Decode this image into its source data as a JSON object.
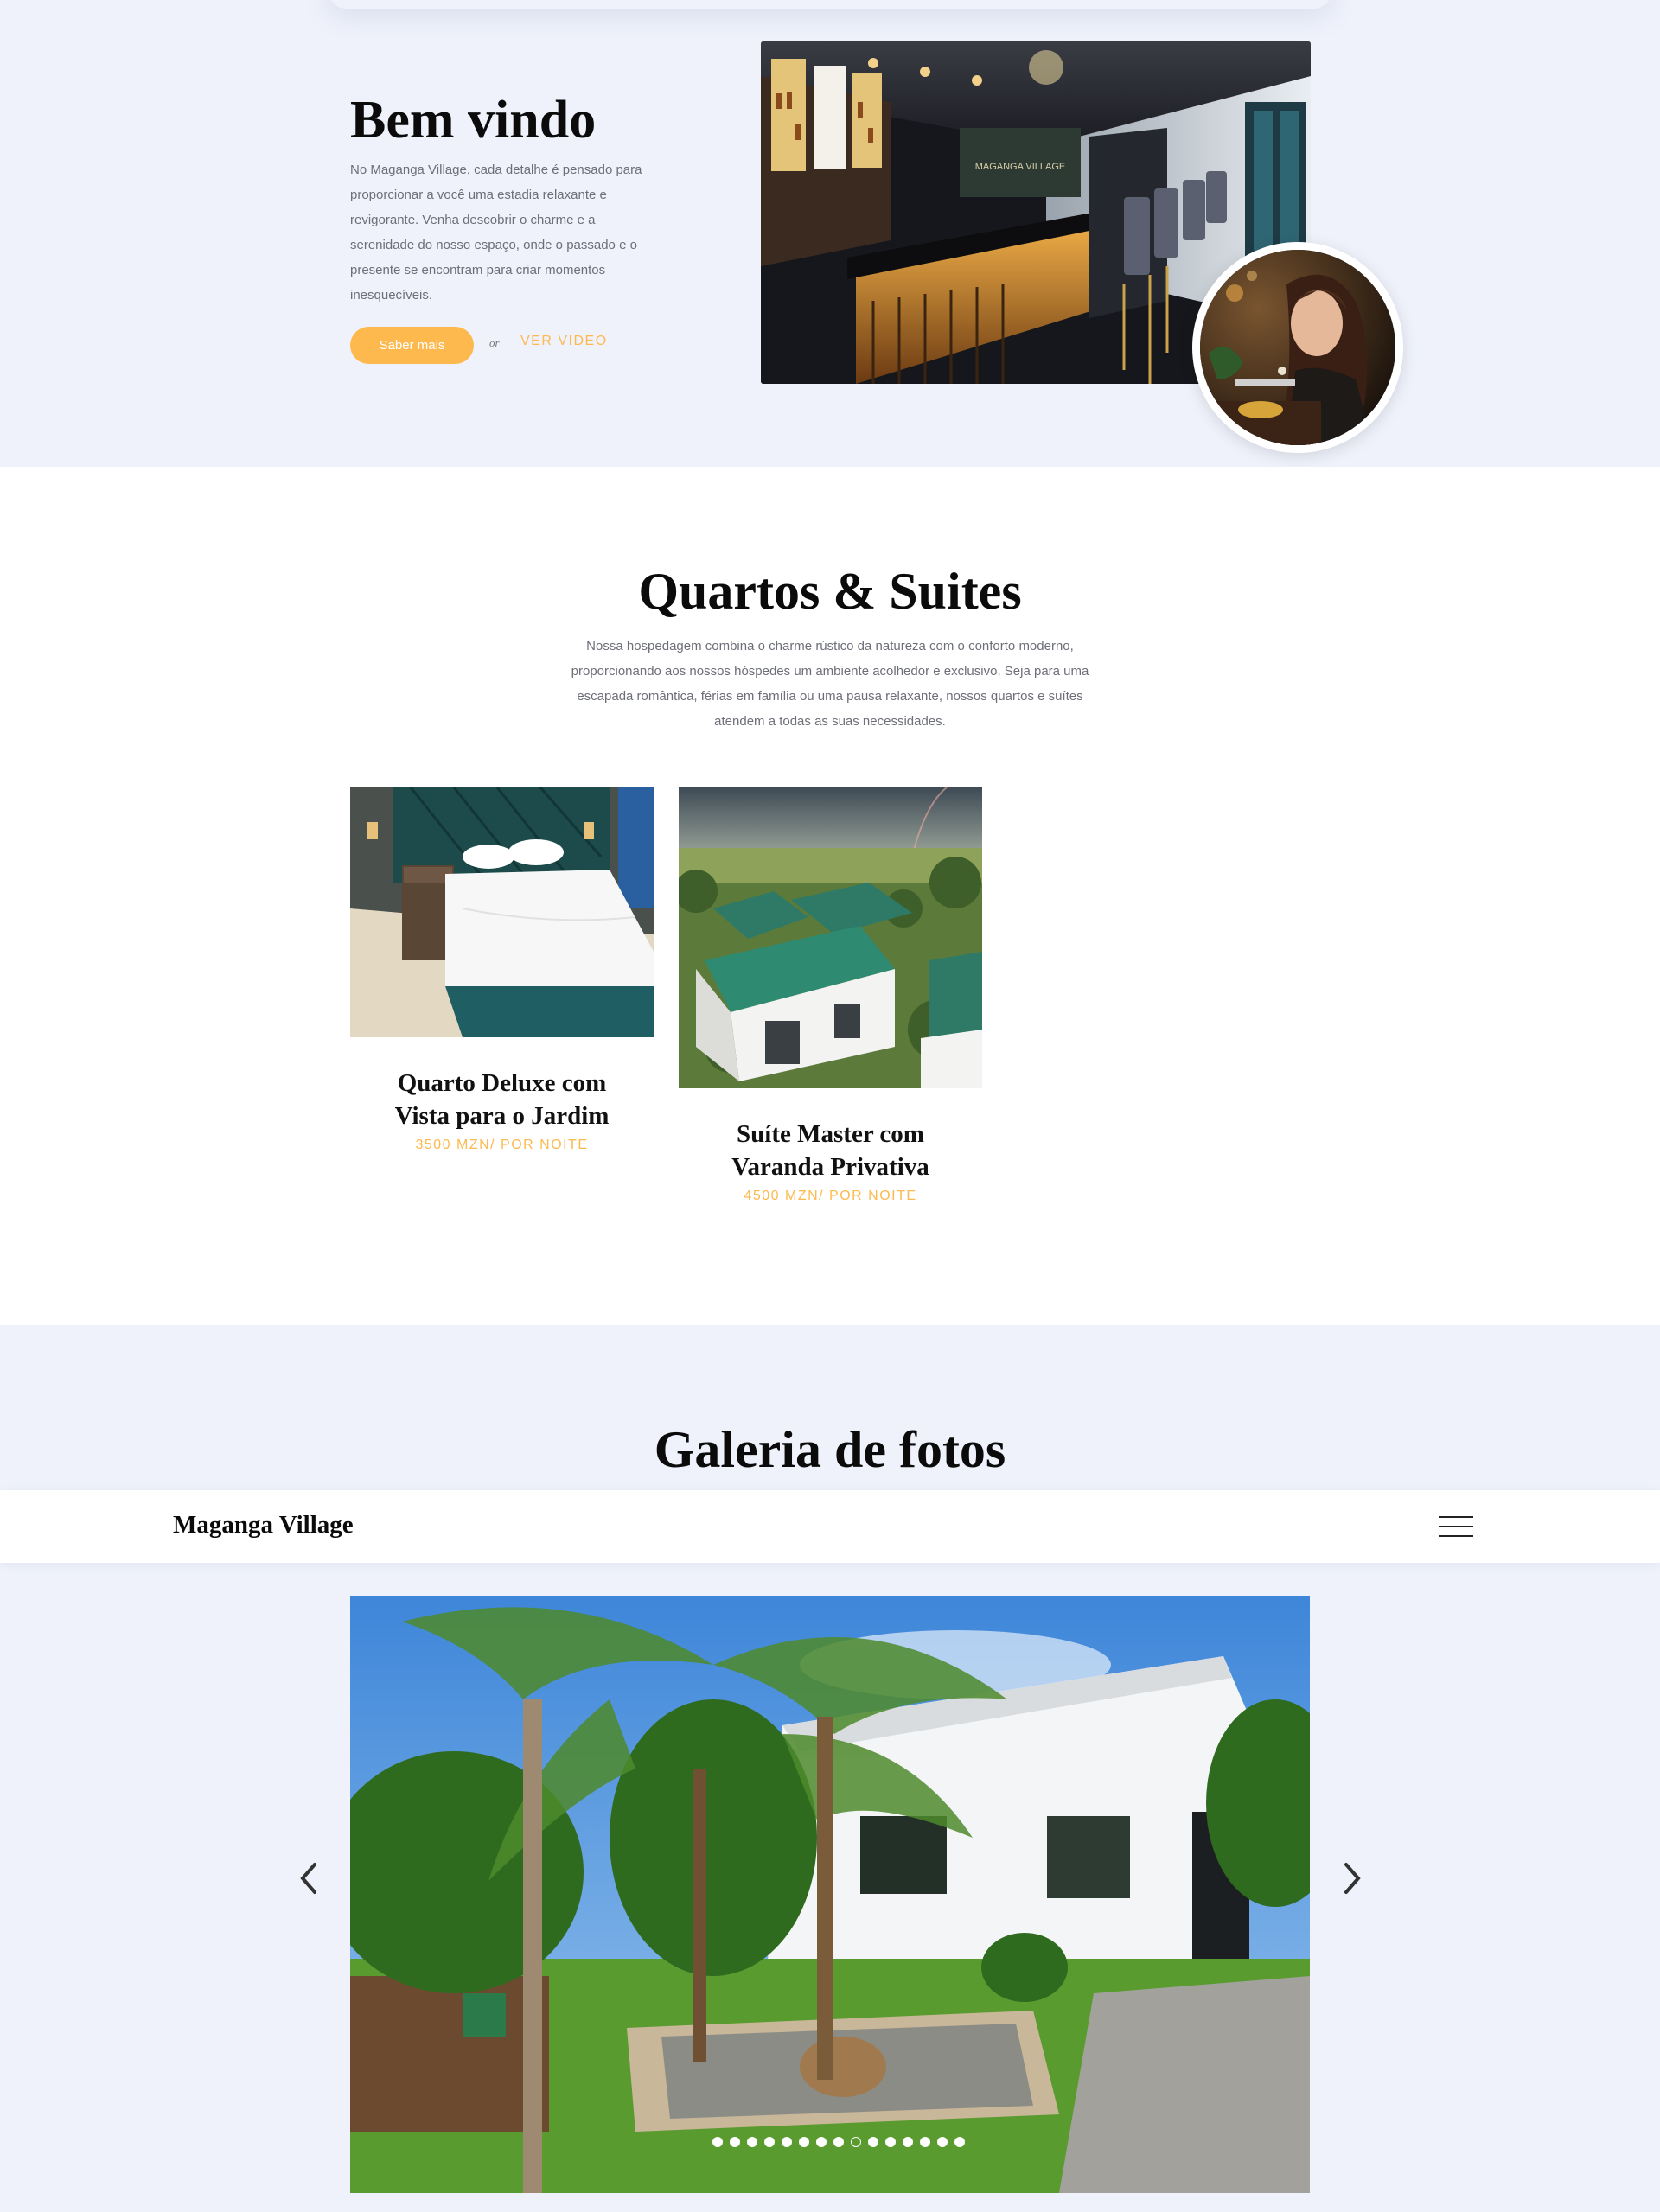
{
  "welcome": {
    "title": "Bem vindo",
    "text": "No Maganga Village, cada detalhe é pensado para proporcionar a você uma estadia relaxante e revigorante. Venha descobrir o charme e a serenidade do nosso espaço, onde o passado e o presente se encontram para criar momentos inesquecíveis.",
    "button_label": "Saber mais",
    "or_label": "or",
    "video_label": "VER VIDEO",
    "bar_sign": "MAGANGA VILLAGE"
  },
  "rooms": {
    "title": "Quartos & Suites",
    "text": "Nossa hospedagem combina o charme rústico da natureza com o conforto moderno, proporcionando aos nossos hóspedes um ambiente acolhedor e exclusivo. Seja para uma escapada romântica, férias em família ou uma pausa relaxante, nossos quartos e suítes atendem a todas as suas necessidades.",
    "items": [
      {
        "name": "Quarto Deluxe com Vista para o Jardim",
        "price": "3500 MZN/ POR NOITE"
      },
      {
        "name": "Suíte Master com Varanda Privativa",
        "price": "4500 MZN/ POR NOITE"
      }
    ]
  },
  "gallery": {
    "title": "Galeria de fotos",
    "dot_count": 15,
    "active_dot": 8
  },
  "navbar": {
    "brand": "Maganga Village"
  },
  "colors": {
    "accent": "#fdb94e",
    "background": "#eff2fb",
    "text_muted": "#6d6f78"
  }
}
